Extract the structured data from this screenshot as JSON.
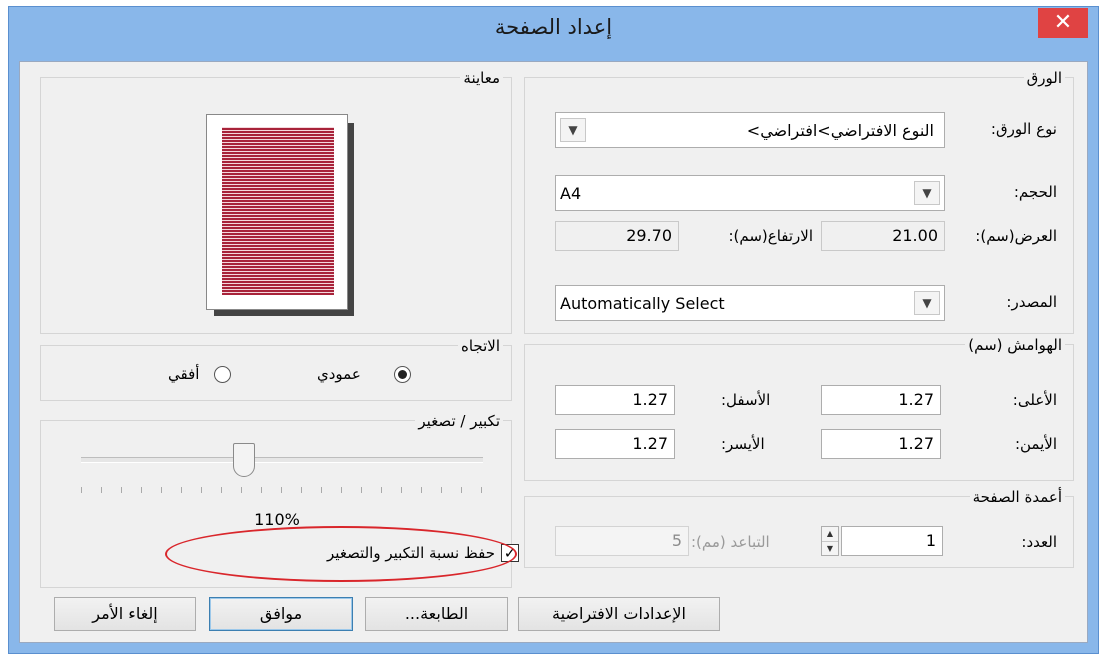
{
  "window": {
    "title": "إعداد الصفحة",
    "close_glyph": "✕"
  },
  "paper": {
    "group_title": "الورق",
    "type_label": "نوع الورق:",
    "type_value": "<النوع الافتراضي>افتراضي",
    "size_label": "الحجم:",
    "size_value": "A4",
    "width_label": "العرض(سم):",
    "width_value": "21.00",
    "height_label": "الارتفاع(سم):",
    "height_value": "29.70",
    "source_label": "المصدر:",
    "source_value": "Automatically Select"
  },
  "margins": {
    "group_title": "الهوامش (سم)",
    "top_label": "الأعلى:",
    "top_value": "1.27",
    "bottom_label": "الأسفل:",
    "bottom_value": "1.27",
    "right_label": "الأيمن:",
    "right_value": "1.27",
    "left_label": "الأيسر:",
    "left_value": "1.27"
  },
  "columns": {
    "group_title": "أعمدة الصفحة",
    "count_label": "العدد:",
    "count_value": "1",
    "spacing_label": "التباعد (مم):",
    "spacing_value": "5"
  },
  "preview": {
    "group_title": "معاينة"
  },
  "orientation": {
    "group_title": "الاتجاه",
    "portrait_label": "عمودي",
    "landscape_label": "أفقي",
    "selected": "portrait"
  },
  "scaling": {
    "group_title": "تكبير / تصغير",
    "value_text": "110%",
    "slider_fraction": 0.4,
    "keep_ratio_label": "حفظ نسبة التكبير والتصغير",
    "keep_ratio_checked": true
  },
  "buttons": {
    "defaults": "الإعدادات الافتراضية",
    "printer": "الطابعة...",
    "ok": "موافق",
    "cancel": "إلغاء الأمر"
  },
  "colors": {
    "annotation_red": "#d9262b",
    "preview_text": "#a8233a",
    "title_bar": "#89b7ea",
    "close_button": "#e04343"
  },
  "icons": {
    "dropdown": "chevron-down-icon",
    "close": "close-icon"
  }
}
